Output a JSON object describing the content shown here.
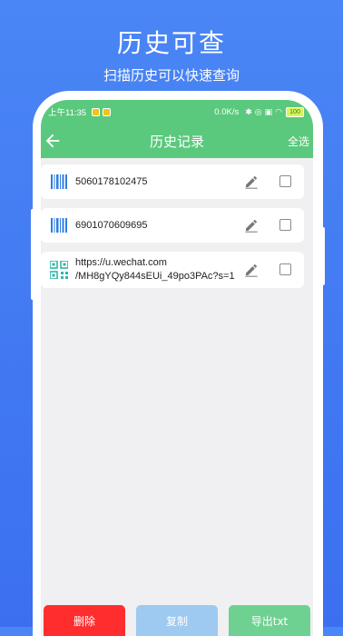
{
  "promo": {
    "title": "历史可查",
    "subtitle": "扫描历史可以快速查询"
  },
  "status_bar": {
    "time": "上午11:35",
    "net_speed": "0.0K/s",
    "battery": "100"
  },
  "app_bar": {
    "title": "历史记录",
    "select_all": "全选"
  },
  "records": [
    {
      "type": "barcode",
      "icon": "barcode-icon",
      "line1": "5060178102475",
      "line2": ""
    },
    {
      "type": "barcode",
      "icon": "barcode-icon",
      "line1": "6901070609695",
      "line2": ""
    },
    {
      "type": "qrcode",
      "icon": "qr-code-icon",
      "line1": "https://u.wechat.com",
      "line2": "/MH8gYQy844sEUi_49po3PAc?s=1"
    }
  ],
  "bottom_actions": {
    "delete": "删除",
    "copy": "复制",
    "export": "导出txt"
  },
  "colors": {
    "background": "#4a86f5",
    "app_bar": "#5bc97d",
    "delete": "#ff2d2d",
    "copy": "#9ec9f0",
    "export": "#6fd191"
  }
}
